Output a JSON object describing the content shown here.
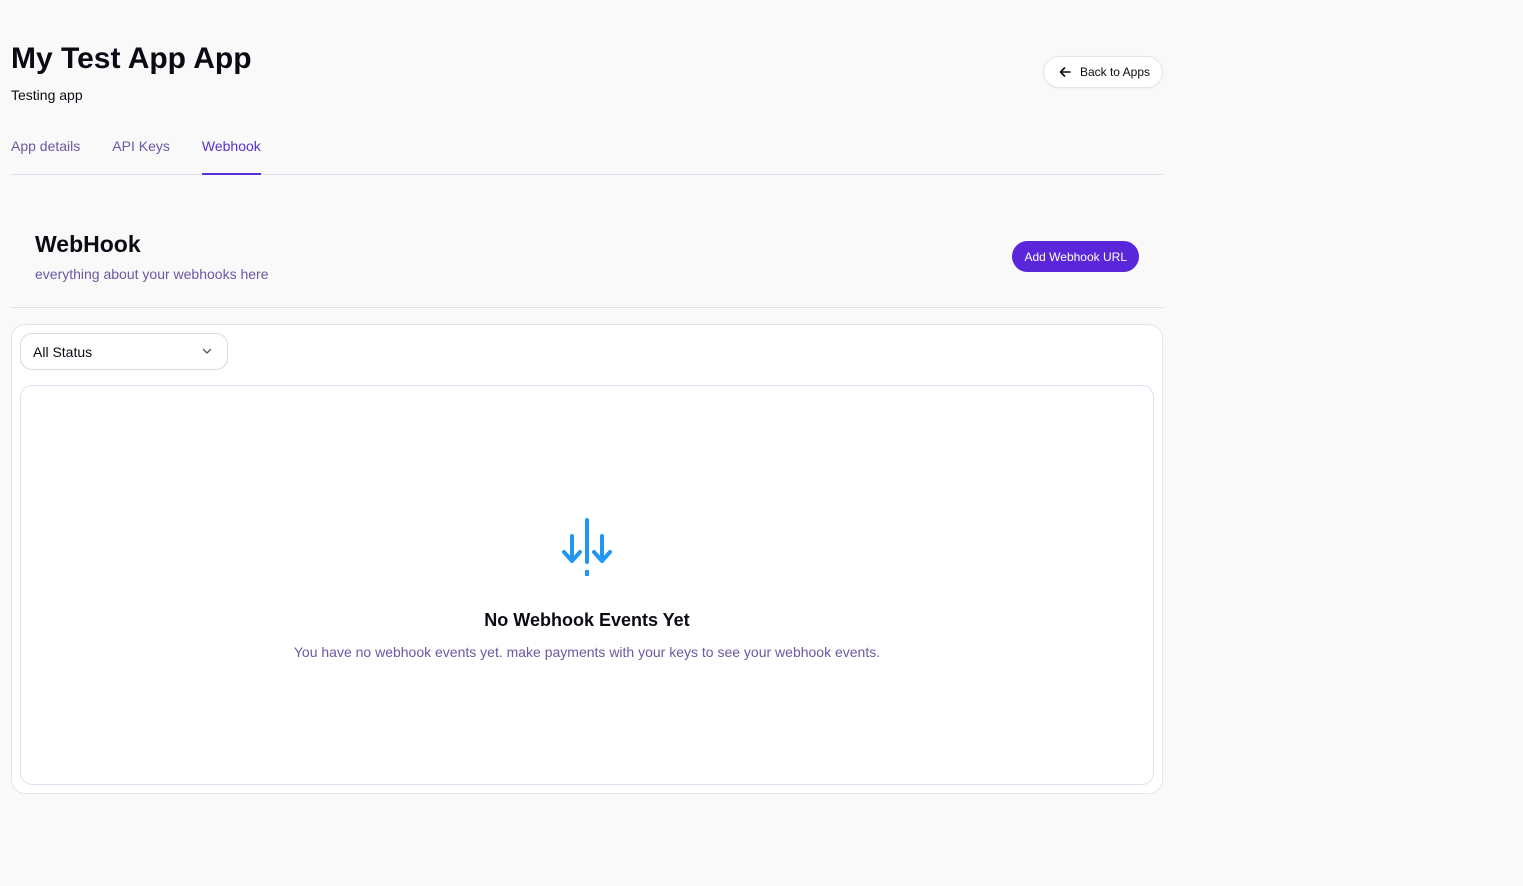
{
  "header": {
    "title": "My Test App App",
    "subtitle": "Testing app",
    "back_button_label": "Back to Apps"
  },
  "tabs": [
    {
      "label": "App details",
      "active": false
    },
    {
      "label": "API Keys",
      "active": false
    },
    {
      "label": "Webhook",
      "active": true
    }
  ],
  "webhook_section": {
    "title": "WebHook",
    "subtitle": "everything about your webhooks here",
    "add_button_label": "Add Webhook URL"
  },
  "filter": {
    "status_value": "All Status"
  },
  "empty_state": {
    "icon": "webhook-arrows-icon",
    "title": "No Webhook Events Yet",
    "message": "You have no webhook events yet. make payments with your keys to see your webhook events."
  },
  "colors": {
    "accent": "#5a26d9",
    "muted_text": "#6b58a3",
    "icon_blue": "#2196f3",
    "background": "#f9f9f9"
  }
}
